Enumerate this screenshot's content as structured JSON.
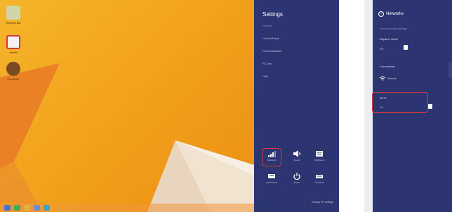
{
  "desktop": {
    "icons": [
      {
        "label": "Recycle Bin",
        "color": "#cfd6a8"
      },
      {
        "label": "Adobe",
        "color": "#d23a3a"
      },
      {
        "label": "Computer",
        "color": "#7a4a20"
      }
    ]
  },
  "settings": {
    "title": "Settings",
    "subtitle": "Desktop",
    "links": [
      "Control Panel",
      "Personalization",
      "PC info",
      "Help"
    ],
    "tiles": [
      {
        "label": "Networks",
        "icon": "wifi-icon"
      },
      {
        "label": "Sound",
        "icon": "speaker-icon"
      },
      {
        "label": "Brightness",
        "icon": "brightness-icon"
      },
      {
        "label": "Notifications",
        "icon": "bell-icon"
      },
      {
        "label": "Power",
        "icon": "power-icon"
      },
      {
        "label": "Keyboard",
        "icon": "keyboard-icon"
      }
    ],
    "footer": "Change PC settings"
  },
  "networks": {
    "title": "Networks",
    "hint": "View connection settings",
    "airplane": {
      "label": "Airplane mode",
      "state": "Off"
    },
    "connections": {
      "label": "Connections",
      "network": "Network"
    },
    "wifi": {
      "label": "Wi-Fi",
      "state": "On"
    }
  },
  "colors": {
    "panel": "#2c3570",
    "highlight": "#e0343b",
    "desktop": "#f2a31d"
  }
}
